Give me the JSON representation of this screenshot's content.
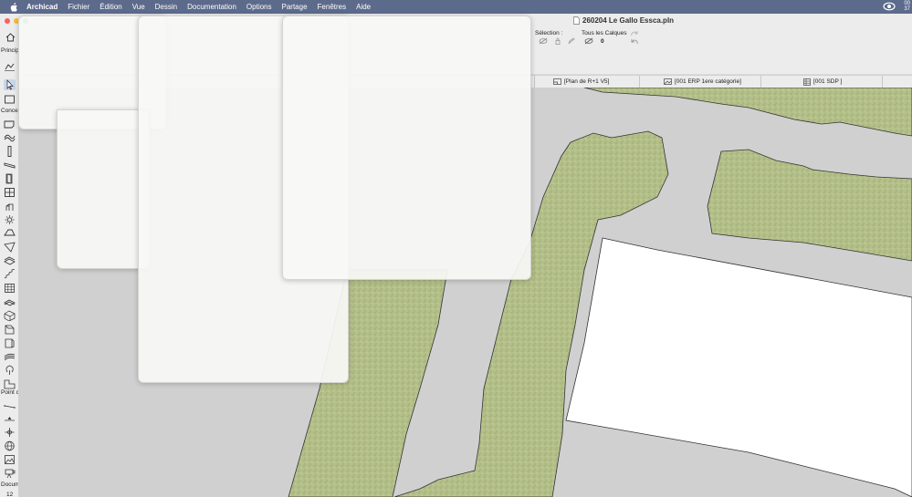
{
  "menubar": {
    "app_name": "Archicad",
    "items": [
      "Fichier",
      "Édition",
      "Vue",
      "Dessin",
      "Documentation",
      "Options",
      "Partage",
      "Fenêtres",
      "Aide"
    ],
    "clock_line1": "00",
    "clock_line2": "37"
  },
  "window": {
    "title": "260204 Le Gallo Essca.pln"
  },
  "toolbar": {
    "principal_label": "Princip",
    "selection_label": "Sélection :",
    "layers_label": "Tous les Calques",
    "layers_count": "0"
  },
  "tabs": [
    {
      "label": "[Plan de R+1 V5]",
      "icon": "floor-plan-icon"
    },
    {
      "label": "[001 ERP 1ere catégorie]",
      "icon": "drawing-icon"
    },
    {
      "label": "[001 SDP ]",
      "icon": "schedule-icon"
    }
  ],
  "toolbox": {
    "conception_label": "Conce",
    "point_label": "Point c",
    "document_label": "Docum",
    "bottom_label": "12"
  },
  "colors": {
    "menubar_bg": "#5c6a8c",
    "grass_fill": "#b7c38a",
    "road_fill": "#d0d0d0",
    "building_fill": "#ffffff"
  }
}
